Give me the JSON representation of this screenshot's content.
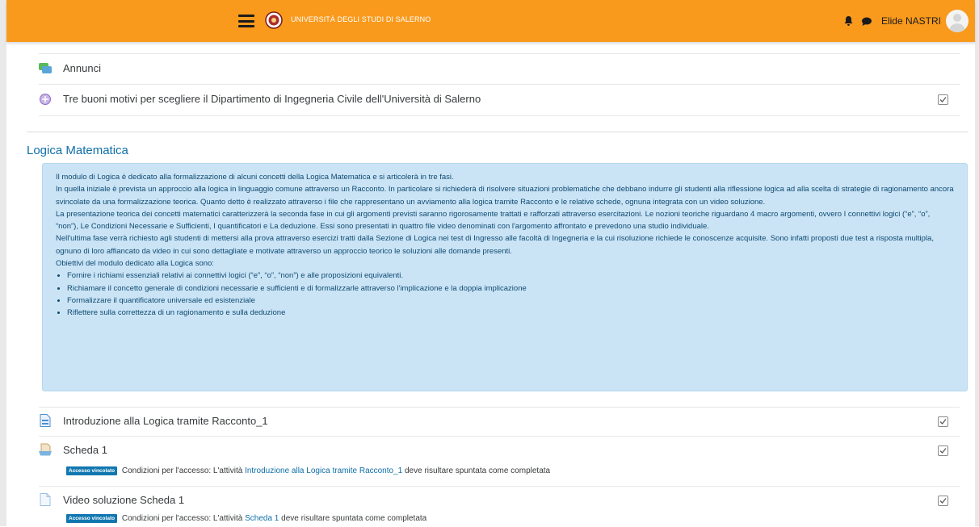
{
  "navbar": {
    "brand": "UNIVERSITÀ DEGLI STUDI DI SALERNO",
    "username": "Elide NASTRI",
    "icons": [
      "menu-icon",
      "university-logo",
      "bell-icon",
      "chat-icon",
      "avatar"
    ],
    "color": "#f99a1d"
  },
  "top_items": [
    {
      "label": "Annunci",
      "icon": "forum-icon"
    },
    {
      "label": "Tre buoni motivi per scegliere il Dipartimento di Ingegneria Civile dell'Università di Salerno",
      "icon": "url-icon",
      "completion": true
    }
  ],
  "section": {
    "title": "Logica Matematica",
    "summary_paragraphs": [
      "Il modulo di Logica è dedicato alla formalizzazione di alcuni concetti della Logica Matematica e si articolerà in tre fasi.",
      "In quella iniziale è prevista un approccio alla logica in linguaggio comune attraverso un Racconto. In particolare si richiederà di risolvere situazioni problematiche che debbano indurre gli studenti alla riflessione logica ad alla scelta di strategie di ragionamento ancora svincolate da una formalizzazione teorica. Quanto detto è realizzato attraverso i file che rappresentano un avviamento alla logica tramite Racconto e le relative schede, ognuna integrata con un video soluzione.",
      "La presentazione teorica dei concetti matematici caratterizzerà la seconda fase in cui gli argomenti previsti saranno rigorosamente trattati e rafforzati attraverso esercitazioni.  Le nozioni teoriche riguardano 4 macro argomenti, ovvero I connettivi logici (“e”, “o”, “non”),  Le Condizioni Necessarie e Sufficienti, I quantificatori e La deduzione. Essi  sono presentati in quattro file video denominati con l'argomento affrontato e prevedono una studio individuale.",
      "Nell'ultima fase verrà richiesto agli studenti di mettersi alla prova attraverso esercizi tratti dalla Sezione di Logica nei test di Ingresso alle facoltà di Ingegneria e la cui risoluzione richiede le conoscenze acquisite. Sono infatti proposti due test a risposta multipla, ognuno di loro affiancato da video in cui sono dettagliate e motivate attraverso un approccio teorico le soluzioni alle domande presenti.",
      "Obiettivi del modulo dedicato alla Logica sono:"
    ],
    "summary_bullets": [
      "Fornire i richiami essenziali relativi ai connettivi logici (“e”, “o”, “non”) e alle proposizioni equivalenti.",
      "Richiamare il concetto generale di condizioni necessarie e sufficienti e di formalizzarle attraverso l'implicazione e la doppia implicazione",
      "Formalizzare il quantificatore universale ed esistenziale",
      "Riflettere sulla correttezza di un ragionamento e sulla deduzione"
    ],
    "activities": [
      {
        "label": "Introduzione alla Logica tramite Racconto_1",
        "icon": "file-icon",
        "completion": true
      },
      {
        "label": "Scheda 1",
        "icon": "resource-icon",
        "completion": true,
        "restriction": {
          "badge": "Accesso vincolato",
          "prefix": "Condizioni per l'accesso: L'attività",
          "link": "Introduzione alla Logica tramite Racconto_1",
          "suffix": "deve risultare spuntata come completata"
        }
      },
      {
        "label": "Video soluzione Scheda 1",
        "icon": "file-icon",
        "completion": true,
        "restriction": {
          "badge": "Accesso vincolato",
          "prefix": "Condizioni per l'accesso: L'attività",
          "link": "Scheda 1",
          "suffix": "deve risultare spuntata come completata"
        }
      }
    ]
  },
  "colors": {
    "section_title": "#0f6fa9",
    "summary_bg": "#cbe4f5",
    "summary_text": "#0d4a73",
    "badge": "#1177b0"
  }
}
